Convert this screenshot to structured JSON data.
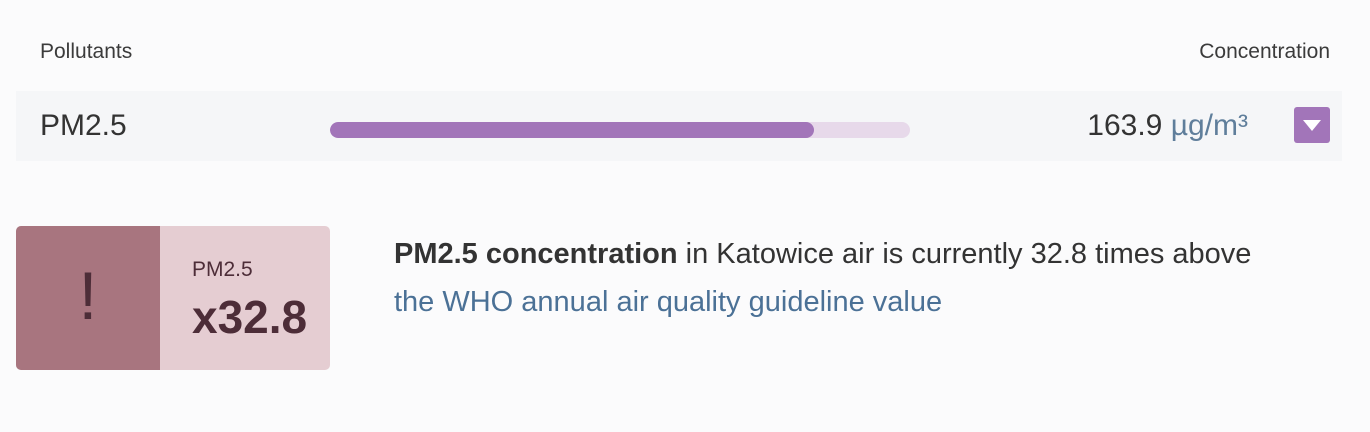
{
  "header": {
    "left_label": "Pollutants",
    "right_label": "Concentration"
  },
  "pollutant_row": {
    "name": "PM2.5",
    "level_fraction": 0.835,
    "value": "163.9",
    "unit": "µg/m³",
    "toggle_icon": "chevron-down-icon"
  },
  "alert_card": {
    "icon_glyph": "!",
    "pollutant": "PM2.5",
    "multiplier": "x32.8"
  },
  "description": {
    "bold": "PM2.5 concentration",
    "mid": " in Katowice air is currently 32.8 times above ",
    "link": "the WHO annual air quality guideline value"
  },
  "colors": {
    "accent_purple": "#a275b9",
    "bar_track": "#e7d9ea",
    "alert_dark": "#a8757f",
    "alert_light": "#e5cdd2",
    "alert_text": "#4d2d38",
    "link": "#4b7196"
  }
}
